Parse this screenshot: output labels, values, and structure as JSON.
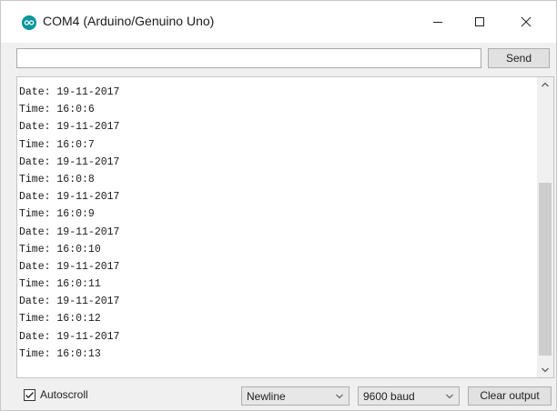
{
  "window": {
    "title": "COM4 (Arduino/Genuino Uno)",
    "icon": "arduino-logo-icon",
    "controls": [
      "minimize-icon",
      "maximize-icon",
      "close-icon"
    ]
  },
  "input_row": {
    "input_value": "",
    "send_label": "Send"
  },
  "output": {
    "lines": [
      "Date: 19-11-2017",
      "Time: 16:0:6",
      "Date: 19-11-2017",
      "Time: 16:0:7",
      "Date: 19-11-2017",
      "Time: 16:0:8",
      "Date: 19-11-2017",
      "Time: 16:0:9",
      "Date: 19-11-2017",
      "Time: 16:0:10",
      "Date: 19-11-2017",
      "Time: 16:0:11",
      "Date: 19-11-2017",
      "Time: 16:0:12",
      "Date: 19-11-2017",
      "Time: 16:0:13"
    ]
  },
  "footer": {
    "autoscroll_label": "Autoscroll",
    "autoscroll_checked": true,
    "line_ending": "Newline",
    "baud_rate": "9600 baud",
    "clear_label": "Clear output"
  },
  "colors": {
    "icon_teal": "#0a979c",
    "window_bg": "#f0f0f0",
    "output_bg": "#ffffff"
  }
}
